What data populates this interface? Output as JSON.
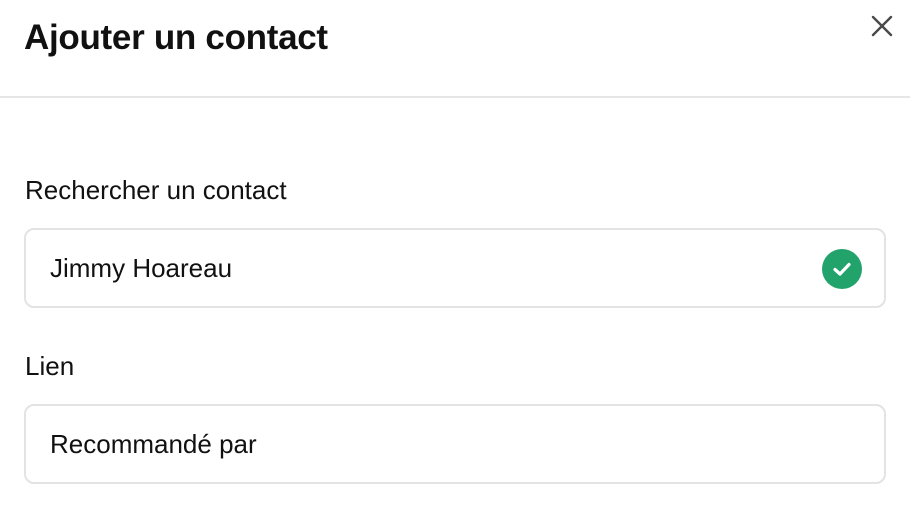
{
  "modal": {
    "title": "Ajouter un contact",
    "close_icon": "close-icon"
  },
  "search_field": {
    "label": "Rechercher un contact",
    "value": "Jimmy Hoareau",
    "status_icon": "check-circle-icon"
  },
  "link_field": {
    "label": "Lien",
    "value": "Recommandé par"
  },
  "colors": {
    "success": "#22A36B",
    "border": "#e3e3e3",
    "divider": "#e6e6e6",
    "text": "#111111"
  }
}
